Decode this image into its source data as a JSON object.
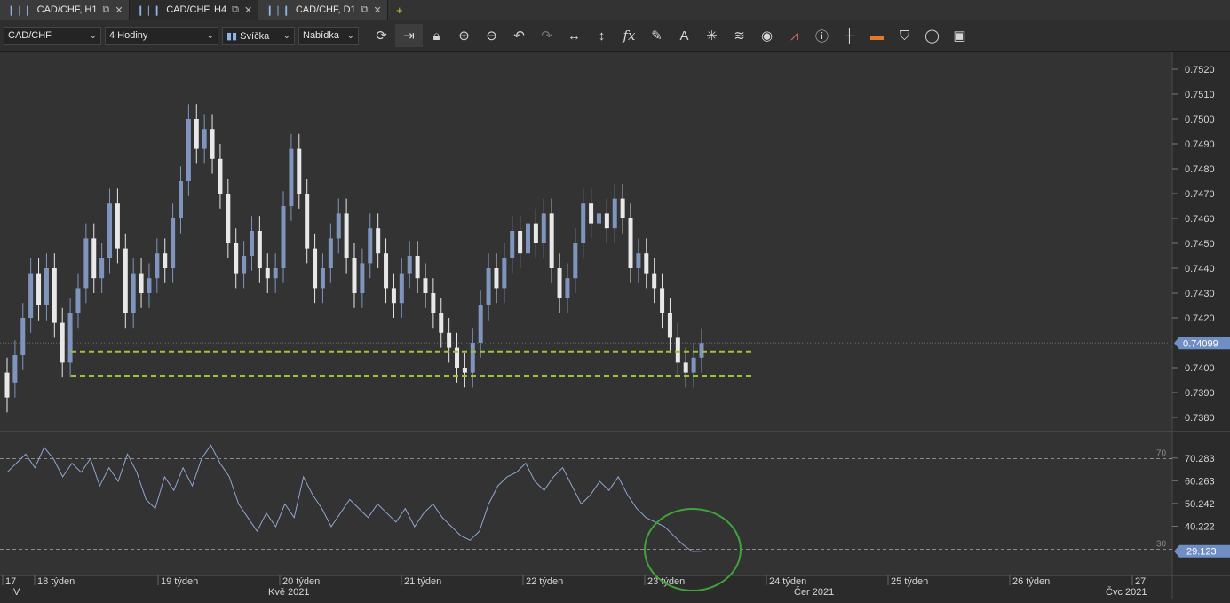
{
  "tabs": [
    {
      "label": "CAD/CHF, H1",
      "active": false
    },
    {
      "label": "CAD/CHF, H4",
      "active": true
    },
    {
      "label": "CAD/CHF, D1",
      "active": false
    }
  ],
  "toolbar": {
    "symbol": "CAD/CHF",
    "timeframe": "4 Hodiny",
    "chart_type": "Svíčka",
    "menu": "Nabídka",
    "icons": [
      "refresh-icon",
      "auto-scroll-icon",
      "lock-icon",
      "zoom-in-icon",
      "zoom-out-icon",
      "undo-icon",
      "redo-icon",
      "horizontal-measure-icon",
      "vertical-measure-icon",
      "indicator-fx-icon",
      "pencil-icon",
      "text-icon",
      "crosshair-star-icon",
      "layers-icon",
      "eye-icon",
      "trade-icon",
      "info-icon",
      "cursor-cross-icon",
      "color-strip-icon",
      "bucket-icon",
      "circle-icon",
      "save-icon"
    ]
  },
  "chart_data": [
    {
      "type": "candlestick",
      "symbol": "CAD/CHF",
      "timeframe": "H4",
      "ylim": [
        0.7375,
        0.7525
      ],
      "y_ticks": [
        "0.7520",
        "0.7510",
        "0.7500",
        "0.7490",
        "0.7480",
        "0.7470",
        "0.7460",
        "0.7450",
        "0.7440",
        "0.7430",
        "0.7420",
        "0.7400",
        "0.7390",
        "0.7380"
      ],
      "last_price": "0.74099",
      "support_levels": [
        0.74065,
        0.73968
      ],
      "support_color": "#9ec23a",
      "bull_color": "#7f95bd",
      "bear_color": "#e8e8e8",
      "candles": [
        [
          0.7398,
          0.7388
        ],
        [
          0.7394,
          0.7405
        ],
        [
          0.7405,
          0.742
        ],
        [
          0.742,
          0.7438
        ],
        [
          0.7438,
          0.7425
        ],
        [
          0.7425,
          0.744
        ],
        [
          0.744,
          0.7418
        ],
        [
          0.7418,
          0.7402
        ],
        [
          0.7402,
          0.7422
        ],
        [
          0.7422,
          0.7432
        ],
        [
          0.7432,
          0.7452
        ],
        [
          0.7452,
          0.7436
        ],
        [
          0.7436,
          0.7444
        ],
        [
          0.7444,
          0.7466
        ],
        [
          0.7466,
          0.7448
        ],
        [
          0.7448,
          0.7422
        ],
        [
          0.7422,
          0.7438
        ],
        [
          0.7438,
          0.743
        ],
        [
          0.743,
          0.7436
        ],
        [
          0.7436,
          0.7446
        ],
        [
          0.7446,
          0.744
        ],
        [
          0.744,
          0.746
        ],
        [
          0.746,
          0.7475
        ],
        [
          0.7475,
          0.75
        ],
        [
          0.75,
          0.7488
        ],
        [
          0.7488,
          0.7496
        ],
        [
          0.7496,
          0.7484
        ],
        [
          0.7484,
          0.747
        ],
        [
          0.747,
          0.745
        ],
        [
          0.745,
          0.7438
        ],
        [
          0.7438,
          0.7445
        ],
        [
          0.7445,
          0.7455
        ],
        [
          0.7455,
          0.744
        ],
        [
          0.744,
          0.7436
        ],
        [
          0.7436,
          0.744
        ],
        [
          0.744,
          0.7465
        ],
        [
          0.7465,
          0.7488
        ],
        [
          0.7488,
          0.747
        ],
        [
          0.747,
          0.7448
        ],
        [
          0.7448,
          0.7432
        ],
        [
          0.7432,
          0.744
        ],
        [
          0.744,
          0.7452
        ],
        [
          0.7452,
          0.7462
        ],
        [
          0.7462,
          0.7444
        ],
        [
          0.7444,
          0.743
        ],
        [
          0.743,
          0.7442
        ],
        [
          0.7442,
          0.7456
        ],
        [
          0.7456,
          0.7446
        ],
        [
          0.7446,
          0.7432
        ],
        [
          0.7432,
          0.7426
        ],
        [
          0.7426,
          0.7438
        ],
        [
          0.7438,
          0.7445
        ],
        [
          0.7445,
          0.7436
        ],
        [
          0.7436,
          0.743
        ],
        [
          0.743,
          0.7422
        ],
        [
          0.7422,
          0.7414
        ],
        [
          0.7414,
          0.7408
        ],
        [
          0.7408,
          0.74
        ],
        [
          0.74,
          0.7398
        ],
        [
          0.7398,
          0.741
        ],
        [
          0.741,
          0.7425
        ],
        [
          0.7425,
          0.744
        ],
        [
          0.744,
          0.7432
        ],
        [
          0.7432,
          0.7444
        ],
        [
          0.7444,
          0.7455
        ],
        [
          0.7455,
          0.7446
        ],
        [
          0.7446,
          0.7458
        ],
        [
          0.7458,
          0.745
        ],
        [
          0.745,
          0.7462
        ],
        [
          0.7462,
          0.744
        ],
        [
          0.744,
          0.7428
        ],
        [
          0.7428,
          0.7436
        ],
        [
          0.7436,
          0.745
        ],
        [
          0.745,
          0.7466
        ],
        [
          0.7466,
          0.7458
        ],
        [
          0.7458,
          0.7462
        ],
        [
          0.7462,
          0.7456
        ],
        [
          0.7456,
          0.7468
        ],
        [
          0.7468,
          0.746
        ],
        [
          0.746,
          0.744
        ],
        [
          0.744,
          0.7446
        ],
        [
          0.7446,
          0.7438
        ],
        [
          0.7438,
          0.7432
        ],
        [
          0.7432,
          0.7422
        ],
        [
          0.7422,
          0.7412
        ],
        [
          0.7412,
          0.7402
        ],
        [
          0.7402,
          0.7398
        ],
        [
          0.7398,
          0.7404
        ],
        [
          0.7404,
          0.74099
        ]
      ]
    },
    {
      "type": "line",
      "name": "RSI",
      "ylim": [
        20,
        80
      ],
      "y_ticks": [
        "70.283",
        "60.263",
        "50.242",
        "40.222"
      ],
      "level_high": "70",
      "level_low": "30",
      "last_value": "29.123",
      "line_color": "#8fa6d2",
      "values": [
        64,
        68,
        72,
        66,
        75,
        70,
        62,
        68,
        64,
        70,
        58,
        66,
        60,
        72,
        64,
        52,
        48,
        62,
        56,
        66,
        58,
        70,
        76,
        68,
        62,
        50,
        44,
        38,
        46,
        40,
        50,
        44,
        62,
        54,
        48,
        40,
        46,
        52,
        48,
        44,
        50,
        46,
        42,
        48,
        40,
        46,
        50,
        44,
        40,
        36,
        34,
        38,
        50,
        58,
        62,
        64,
        68,
        60,
        56,
        62,
        66,
        58,
        50,
        54,
        60,
        56,
        62,
        54,
        48,
        44,
        42,
        40,
        36,
        32,
        29,
        29.123
      ]
    }
  ],
  "time_axis": {
    "week_labels": [
      "17",
      "18 týden",
      "19 týden",
      "20 týden",
      "21 týden",
      "22 týden",
      "23 týden",
      "24 týden",
      "25 týden",
      "26 týden",
      "27"
    ],
    "month_labels": [
      "IV",
      "Kvě 2021",
      "Čer 2021",
      "Čvc 2021"
    ]
  },
  "annotation": {
    "type": "ellipse",
    "color": "#3fa33a"
  }
}
